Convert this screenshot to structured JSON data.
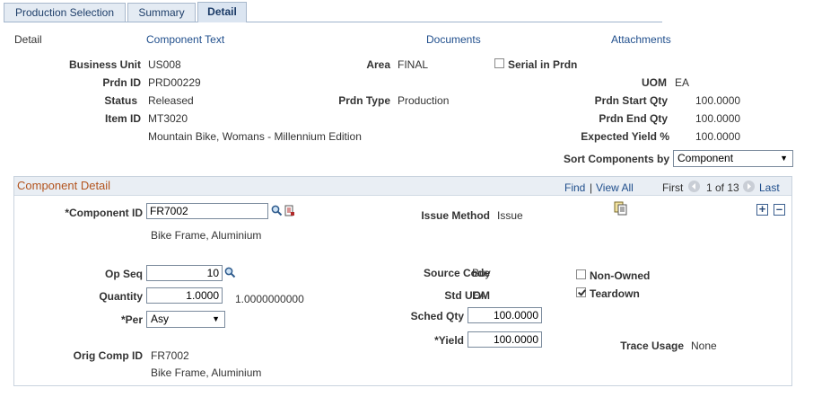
{
  "tabs": [
    {
      "label": "Production Selection",
      "active": false
    },
    {
      "label": "Summary",
      "active": false
    },
    {
      "label": "Detail",
      "active": true
    }
  ],
  "header_links": {
    "detail": "Detail",
    "component_text": "Component Text",
    "documents": "Documents",
    "attachments": "Attachments"
  },
  "header": {
    "business_unit_label": "Business Unit",
    "business_unit": "US008",
    "area_label": "Area",
    "area": "FINAL",
    "serial_label": "Serial in Prdn",
    "serial_checked": false,
    "prdn_id_label": "Prdn ID",
    "prdn_id": "PRD00229",
    "uom_label": "UOM",
    "uom": "EA",
    "status_label": "Status",
    "status": "Released",
    "prdn_type_label": "Prdn Type",
    "prdn_type": "Production",
    "start_qty_label": "Prdn Start Qty",
    "start_qty": "100.0000",
    "item_id_label": "Item ID",
    "item_id": "MT3020",
    "end_qty_label": "Prdn End Qty",
    "end_qty": "100.0000",
    "item_desc": "Mountain Bike, Womans - Millennium Edition",
    "yield_label": "Expected Yield %",
    "yield": "100.0000",
    "sort_label": "Sort Components by",
    "sort_value": "Component"
  },
  "component_detail": {
    "title": "Component Detail",
    "find": "Find",
    "separator": "|",
    "view_all": "View All",
    "first": "First",
    "range": "1 of 13",
    "last": "Last",
    "component_id_label": "*Component ID",
    "component_id": "FR7002",
    "component_desc": "Bike Frame, Aluminium",
    "issue_method_label": "Issue Method",
    "issue_method": "Issue",
    "op_seq_label": "Op Seq",
    "op_seq": "10",
    "source_code_label": "Source Code",
    "source_code": "Buy",
    "non_owned_label": "Non-Owned",
    "non_owned_checked": false,
    "quantity_label": "Quantity",
    "quantity": "1.0000",
    "quantity_precise": "1.0000000000",
    "std_uom_label": "Std UOM",
    "std_uom": "EA",
    "teardown_label": "Teardown",
    "teardown_checked": true,
    "per_label": "*Per",
    "per": "Asy",
    "sched_qty_label": "Sched Qty",
    "sched_qty": "100.0000",
    "yield_label": "*Yield",
    "yield": "100.0000",
    "trace_usage_label": "Trace Usage",
    "trace_usage": "None",
    "orig_comp_label": "Orig Comp ID",
    "orig_comp_id": "FR7002",
    "orig_comp_desc": "Bike Frame, Aluminium"
  },
  "colors": {
    "link": "#1f4e8c",
    "section_title": "#b3541e",
    "header_bg": "#e9eef4"
  },
  "icons": [
    "search-icon",
    "detail-page-icon",
    "related-content-icon",
    "prev-arrow-icon",
    "next-arrow-icon",
    "add-row-icon",
    "delete-row-icon"
  ]
}
